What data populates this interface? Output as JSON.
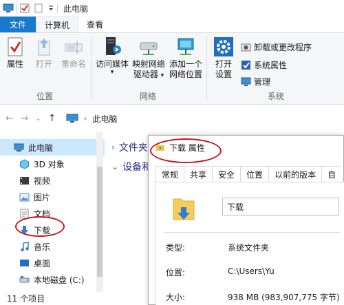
{
  "window": {
    "title": "此电脑"
  },
  "tabs": [
    {
      "label": "文件"
    },
    {
      "label": "计算机"
    },
    {
      "label": "查看"
    }
  ],
  "ribbon": {
    "location": {
      "label": "位置",
      "buttons": [
        {
          "label": "属性"
        },
        {
          "label": "打开"
        },
        {
          "label": "重命名"
        }
      ]
    },
    "network": {
      "label": "网络",
      "access_media": "访问媒体",
      "map_drive_line1": "映射网络",
      "map_drive_line2": "驱动器",
      "add_location_line1": "添加一个",
      "add_location_line2": "网络位置"
    },
    "system": {
      "label": "系统",
      "open_settings_line1": "打开",
      "open_settings_line2": "设置",
      "uninstall": "卸载或更改程序",
      "system_properties": "系统属性",
      "manage": "管理"
    }
  },
  "address": {
    "path": "此电脑"
  },
  "sidebar": {
    "items": [
      {
        "label": "此电脑"
      },
      {
        "label": "3D 对象"
      },
      {
        "label": "视频"
      },
      {
        "label": "图片"
      },
      {
        "label": "文档"
      },
      {
        "label": "下载"
      },
      {
        "label": "音乐"
      },
      {
        "label": "桌面"
      },
      {
        "label": "本地磁盘 (C:)"
      }
    ]
  },
  "main": {
    "sections": [
      {
        "label": "文件夹"
      },
      {
        "label": "设备和"
      }
    ]
  },
  "status": {
    "count": "11 个项目"
  },
  "dialog": {
    "title": "下载 属性",
    "tabs": [
      {
        "label": "常规"
      },
      {
        "label": "共享"
      },
      {
        "label": "安全"
      },
      {
        "label": "位置"
      },
      {
        "label": "以前的版本"
      },
      {
        "label": "自"
      }
    ],
    "name": "下载",
    "props": [
      {
        "label": "类型:",
        "value": "系统文件夹"
      },
      {
        "label": "位置:",
        "value": "C:\\Users\\Yu"
      },
      {
        "label": "大小:",
        "value": "938 MB (983,907,775 字节)"
      }
    ]
  },
  "colors": {
    "accent": "#1979ca",
    "selected": "#cce8ff",
    "annotation": "#c8141e"
  }
}
